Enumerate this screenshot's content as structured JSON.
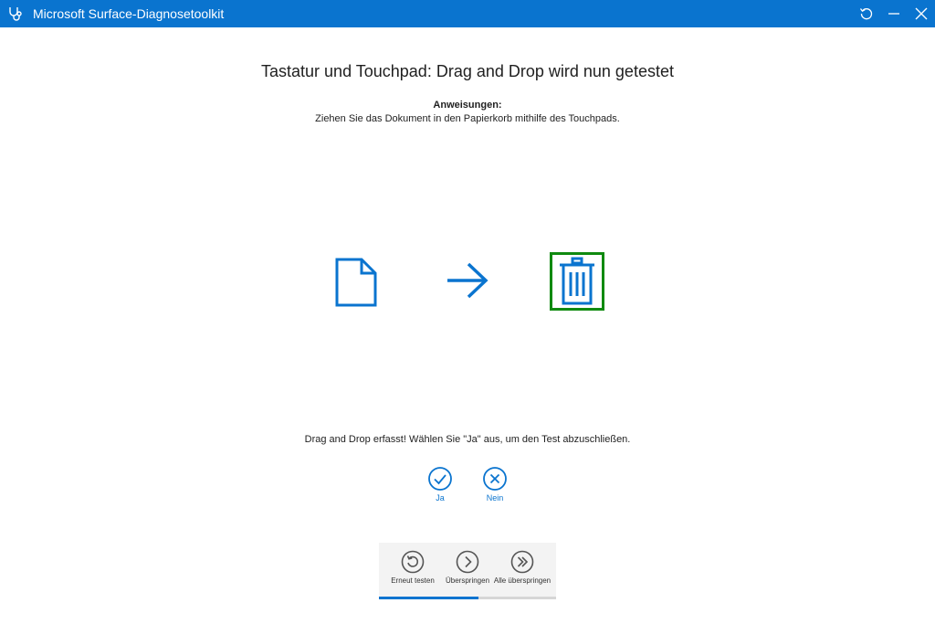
{
  "window": {
    "title": "Microsoft Surface-Diagnosetoolkit",
    "icons": [
      "stethoscope-icon",
      "restart-icon",
      "minimize-icon",
      "close-icon"
    ],
    "accent": "#0a74cf"
  },
  "test": {
    "heading": "Tastatur und Touchpad: Drag and Drop wird nun getestet",
    "instructions_label": "Anweisungen:",
    "instructions_text": "Ziehen Sie das Dokument in den Papierkorb mithilfe des Touchpads.",
    "illustration_icons": [
      "document-icon",
      "arrow-right-icon",
      "trash-icon"
    ],
    "target_highlight_color": "#108a10",
    "status": "Drag and Drop erfasst! Wählen Sie \"Ja\" aus, um den Test abzuschließen."
  },
  "choices": {
    "yes_label": "Ja",
    "no_label": "Nein"
  },
  "actions": {
    "retry_label": "Erneut testen",
    "skip_label": "Überspringen",
    "skip_all_label": "Alle überspringen"
  },
  "progress": {
    "fraction": 0.56
  }
}
